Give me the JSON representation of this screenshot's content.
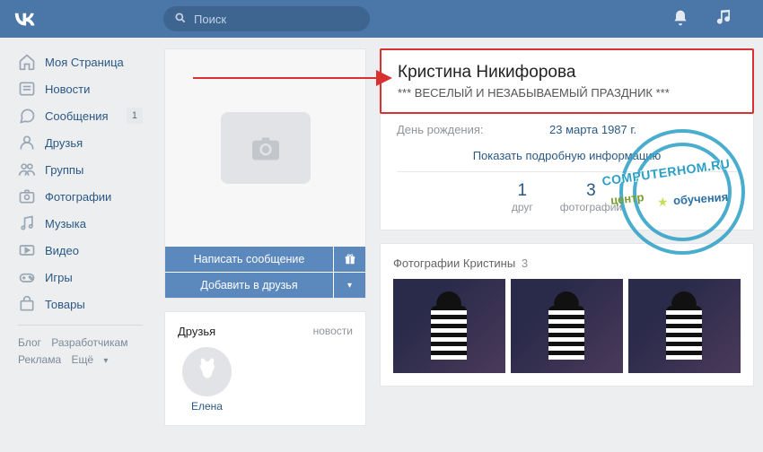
{
  "header": {
    "search_placeholder": "Поиск"
  },
  "sidebar": {
    "items": [
      {
        "label": "Моя Страница",
        "icon": "home"
      },
      {
        "label": "Новости",
        "icon": "news"
      },
      {
        "label": "Сообщения",
        "icon": "messages",
        "badge": "1"
      },
      {
        "label": "Друзья",
        "icon": "friend"
      },
      {
        "label": "Группы",
        "icon": "groups"
      },
      {
        "label": "Фотографии",
        "icon": "photos"
      },
      {
        "label": "Музыка",
        "icon": "music"
      },
      {
        "label": "Видео",
        "icon": "video"
      },
      {
        "label": "Игры",
        "icon": "games"
      },
      {
        "label": "Товары",
        "icon": "market"
      }
    ],
    "footer": {
      "blog": "Блог",
      "developers": "Разработчикам",
      "ads": "Реклама",
      "more": "Ещё"
    }
  },
  "profile": {
    "name": "Кристина Никифорова",
    "status": "*** ВЕСЕЛЫЙ И НЕЗАБЫВАЕМЫЙ ПРАЗДНИК ***",
    "birthday_label": "День рождения:",
    "birthday_value": "23 марта 1987 г.",
    "show_full": "Показать подробную информацию",
    "write_message": "Написать сообщение",
    "add_friend": "Добавить в друзья",
    "stats": [
      {
        "num": "1",
        "label": "друг"
      },
      {
        "num": "3",
        "label": "фотографии"
      }
    ]
  },
  "friends": {
    "title": "Друзья",
    "subtitle": "новости",
    "list": [
      {
        "name": "Елена"
      }
    ]
  },
  "photos": {
    "title": "Фотографии Кристины",
    "count": "3"
  },
  "watermark": {
    "line1": "COMPUTERHOM.RU",
    "line2a": "центр",
    "line2b": "обучения"
  }
}
